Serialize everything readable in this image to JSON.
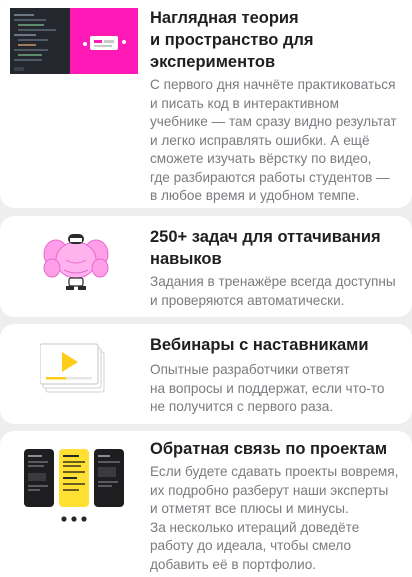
{
  "cards": [
    {
      "title_lines": [
        "Наглядная теория",
        "и пространство для",
        "экспериментов"
      ],
      "text_lines": [
        "С первого дня начнёте практиковаться",
        "и писать код в интерактивном",
        "учебнике — там сразу видно результат",
        "и легко исправлять ошибки. А ещё",
        "сможете изучать вёрстку по видео,",
        "где разбираются работы студентов —",
        "в любое время и удобном темпе."
      ],
      "illustration": "code-editor-preview-image"
    },
    {
      "title_lines": [
        "250+ задач для оттачивания",
        "навыков"
      ],
      "text_lines": [
        "Задания в тренажёре всегда доступны",
        "и проверяются автоматически."
      ],
      "illustration": "muscle-character-image"
    },
    {
      "title_lines": [
        "Вебинары с наставниками"
      ],
      "text_lines": [
        "Опытные разработчики ответят",
        "на вопросы и поддержат, если что-то",
        "не получится с первого раза."
      ],
      "illustration": "video-play-icon"
    },
    {
      "title_lines": [
        "Обратная связь по проектам"
      ],
      "text_lines": [
        "Если будете сдавать проекты вовремя,",
        "их подробно разберут наши эксперты",
        "и отметят все плюсы и минусы.",
        "За несколько итераций доведёте",
        "работу до идеала, чтобы смело",
        "добавить её в портфолио."
      ],
      "illustration": "project-review-screens-image"
    }
  ],
  "colors": {
    "background": "#eeeeef",
    "card": "#ffffff",
    "title": "#1f1f1f",
    "text": "#7b7b80",
    "accent_magenta": "#ff1ab8",
    "accent_yellow": "#ffe033",
    "editor_dark": "#24282e"
  }
}
